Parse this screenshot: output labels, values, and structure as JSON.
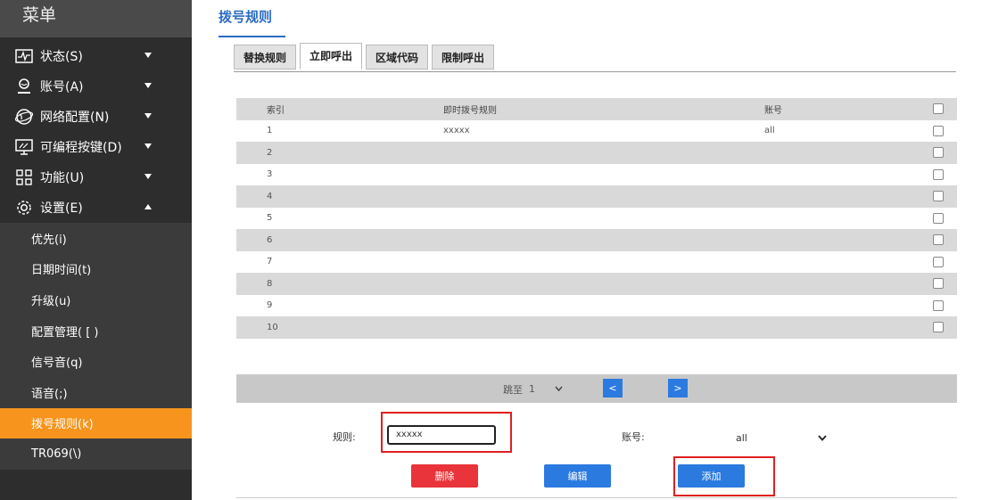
{
  "sidebar": {
    "title": "菜单",
    "items": [
      {
        "label": "状态(S)",
        "icon": "status-monitor-icon",
        "expanded": false
      },
      {
        "label": "账号(A)",
        "icon": "user-icon",
        "expanded": false
      },
      {
        "label": "网络配置(N)",
        "icon": "globe-icon",
        "expanded": false
      },
      {
        "label": "可编程按键(D)",
        "icon": "keyboard-icon",
        "expanded": false
      },
      {
        "label": "功能(U)",
        "icon": "grid-icon",
        "expanded": false
      },
      {
        "label": "设置(E)",
        "icon": "gear-icon",
        "expanded": true
      }
    ],
    "sub_items": [
      {
        "label": "优先(i)"
      },
      {
        "label": "日期时间(t)"
      },
      {
        "label": "升级(u)"
      },
      {
        "label": "配置管理( [ )"
      },
      {
        "label": "信号音(q)"
      },
      {
        "label": "语音(;)"
      },
      {
        "label": "拨号规则(k)",
        "active": true
      },
      {
        "label": "TR069(\\)"
      }
    ]
  },
  "main": {
    "title": "拨号规则",
    "tabs": [
      {
        "label": "替换规则"
      },
      {
        "label": "立即呼出",
        "active": true
      },
      {
        "label": "区域代码"
      },
      {
        "label": "限制呼出"
      }
    ],
    "table": {
      "headers": {
        "index": "索引",
        "rule": "即时拨号规则",
        "account": "账号"
      },
      "rows": [
        {
          "index": "1",
          "rule": "xxxxx",
          "account": "all"
        },
        {
          "index": "2",
          "rule": "",
          "account": ""
        },
        {
          "index": "3",
          "rule": "",
          "account": ""
        },
        {
          "index": "4",
          "rule": "",
          "account": ""
        },
        {
          "index": "5",
          "rule": "",
          "account": ""
        },
        {
          "index": "6",
          "rule": "",
          "account": ""
        },
        {
          "index": "7",
          "rule": "",
          "account": ""
        },
        {
          "index": "8",
          "rule": "",
          "account": ""
        },
        {
          "index": "9",
          "rule": "",
          "account": ""
        },
        {
          "index": "10",
          "rule": "",
          "account": ""
        }
      ]
    },
    "pager": {
      "jump_label": "跳至",
      "page": "1",
      "prev": "<",
      "next": ">"
    },
    "form": {
      "rule_label": "规则:",
      "rule_value": "xxxxx",
      "account_label": "账号:",
      "account_value": "all"
    },
    "buttons": {
      "delete": "删除",
      "edit": "编辑",
      "add": "添加"
    }
  },
  "colors": {
    "sidebar_bg": "#2d2d2d",
    "active_item": "#f7941d",
    "accent_blue": "#2b7ae0",
    "delete_red": "#e8343a",
    "highlight_box": "#e02020"
  }
}
